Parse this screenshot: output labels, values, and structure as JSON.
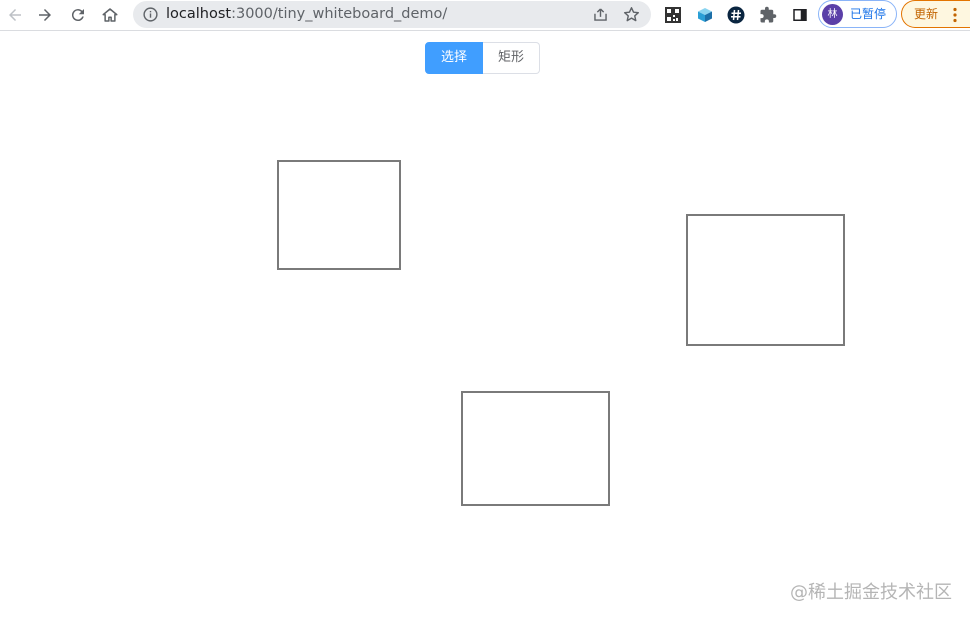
{
  "browser": {
    "url_host": "localhost",
    "url_path": ":3000/tiny_whiteboard_demo/",
    "profile_label": "已暂停",
    "profile_initial": "林",
    "update_label": "更新",
    "icons": [
      "back-icon",
      "forward-icon",
      "reload-icon",
      "home-icon",
      "info-icon",
      "share-icon",
      "star-icon",
      "qr-code-icon",
      "cube-extension-icon",
      "hashtag-extension-icon",
      "puzzle-icon",
      "side-panel-icon",
      "more-vert-icon"
    ]
  },
  "toolbar": {
    "select_label": "选择",
    "rect_label": "矩形",
    "active_tool": "select"
  },
  "canvas": {
    "shape_count": 3,
    "shape_type": "rectangle"
  },
  "watermark": "@稀土掘金技术社区",
  "colors": {
    "accent": "#409eff",
    "shape_stroke": "#7a7a7a"
  }
}
